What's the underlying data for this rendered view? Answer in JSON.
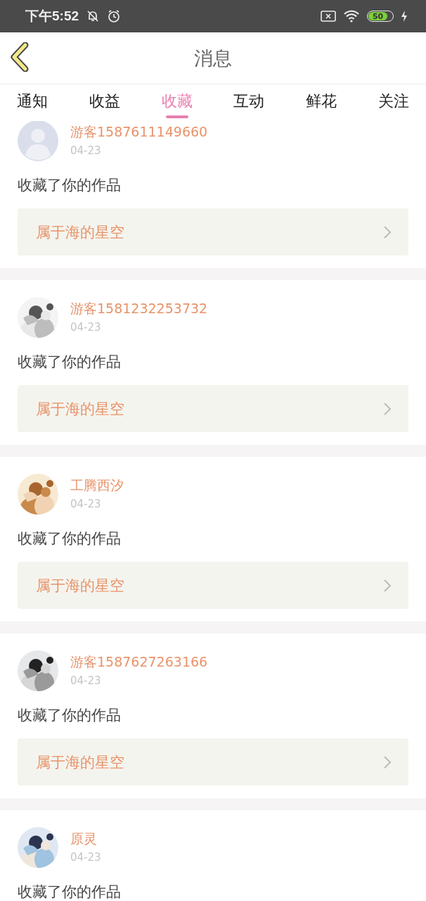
{
  "status_bar": {
    "time": "下午5:52",
    "battery": "50"
  },
  "header": {
    "title": "消息"
  },
  "tabs": [
    {
      "label": "通知",
      "selected": false
    },
    {
      "label": "收益",
      "selected": false
    },
    {
      "label": "收藏",
      "selected": true
    },
    {
      "label": "互动",
      "selected": false
    },
    {
      "label": "鲜花",
      "selected": false
    },
    {
      "label": "关注",
      "selected": false
    }
  ],
  "messages": [
    {
      "avatar": {
        "kind": "default"
      },
      "user": "游客1587611149660",
      "date": "04-23",
      "text": "收藏了你的作品",
      "work": "属于海的星空"
    },
    {
      "user": "游客1581232253732",
      "date": "04-23",
      "text": "收藏了你的作品",
      "work": "属于海的星空"
    },
    {
      "user": "工腾西汐",
      "date": "04-23",
      "text": "收藏了你的作品",
      "work": "属于海的星空"
    },
    {
      "user": "游客1587627263166",
      "date": "04-23",
      "text": "收藏了你的作品",
      "work": "属于海的星空"
    },
    {
      "user": "原灵",
      "date": "04-23",
      "text": "收藏了你的作品"
    }
  ]
}
